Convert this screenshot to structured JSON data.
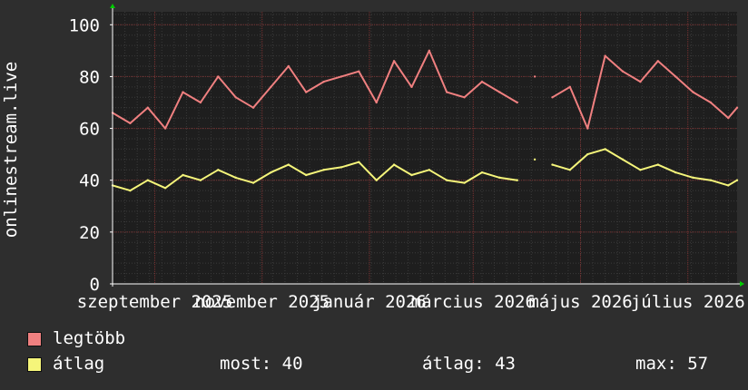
{
  "chart_data": {
    "type": "line",
    "ylabel": "onlinestream.live",
    "ylim": [
      0,
      105
    ],
    "yticks": [
      0,
      20,
      40,
      60,
      80,
      100
    ],
    "xlim": [
      "2025-08-22",
      "2026-08-12"
    ],
    "xticks": [
      {
        "date": "2025-09-15",
        "label": "szeptember 2025"
      },
      {
        "date": "2025-11-15",
        "label": "november 2025"
      },
      {
        "date": "2026-01-15",
        "label": "január 2026"
      },
      {
        "date": "2026-03-15",
        "label": "március 2026"
      },
      {
        "date": "2026-05-15",
        "label": "május 2026"
      },
      {
        "date": "2026-07-15",
        "label": "július 2026"
      }
    ],
    "grid": true,
    "x": [
      "2025-08-22",
      "2025-09-01",
      "2025-09-11",
      "2025-09-21",
      "2025-10-01",
      "2025-10-11",
      "2025-10-21",
      "2025-10-31",
      "2025-11-10",
      "2025-11-20",
      "2025-11-30",
      "2025-12-10",
      "2025-12-20",
      "2025-12-30",
      "2026-01-09",
      "2026-01-19",
      "2026-01-29",
      "2026-02-08",
      "2026-02-18",
      "2026-02-28",
      "2026-03-10",
      "2026-03-20",
      "2026-03-30",
      "2026-04-09",
      "2026-04-19",
      "2026-04-29",
      "2026-05-09",
      "2026-05-19",
      "2026-05-29",
      "2026-06-08",
      "2026-06-18",
      "2026-06-28",
      "2026-07-08",
      "2026-07-18",
      "2026-07-28",
      "2026-08-07",
      "2026-08-12"
    ],
    "series": [
      {
        "name": "legtöbb",
        "color": "#f08080",
        "values": [
          66,
          62,
          68,
          60,
          74,
          70,
          80,
          72,
          68,
          76,
          84,
          74,
          78,
          80,
          82,
          70,
          86,
          76,
          90,
          74,
          72,
          78,
          74,
          70,
          80,
          72,
          76,
          60,
          88,
          82,
          78,
          86,
          80,
          74,
          70,
          64,
          68
        ]
      },
      {
        "name": "átlag",
        "color": "#f5f57a",
        "values": [
          38,
          36,
          40,
          37,
          42,
          40,
          44,
          41,
          39,
          43,
          46,
          42,
          44,
          45,
          47,
          40,
          46,
          42,
          44,
          40,
          39,
          43,
          41,
          40,
          48,
          46,
          44,
          50,
          52,
          48,
          44,
          46,
          43,
          41,
          40,
          38,
          40
        ]
      }
    ],
    "gaps": [
      {
        "from": "2026-04-15",
        "to": "2026-04-19"
      }
    ]
  },
  "legend": {
    "max_label": "legtöbb",
    "avg_label": "átlag"
  },
  "stats": {
    "now": "most: 40",
    "avg": "átlag: 43",
    "max": "max: 57"
  },
  "colors": {
    "background": "#2e2e2e",
    "plot_bg": "#1e1e1e",
    "grid_minor": "#3a3a3a",
    "grid_major": "#7a3030",
    "axis": "#ffffff",
    "arrow": "#00cc00"
  }
}
